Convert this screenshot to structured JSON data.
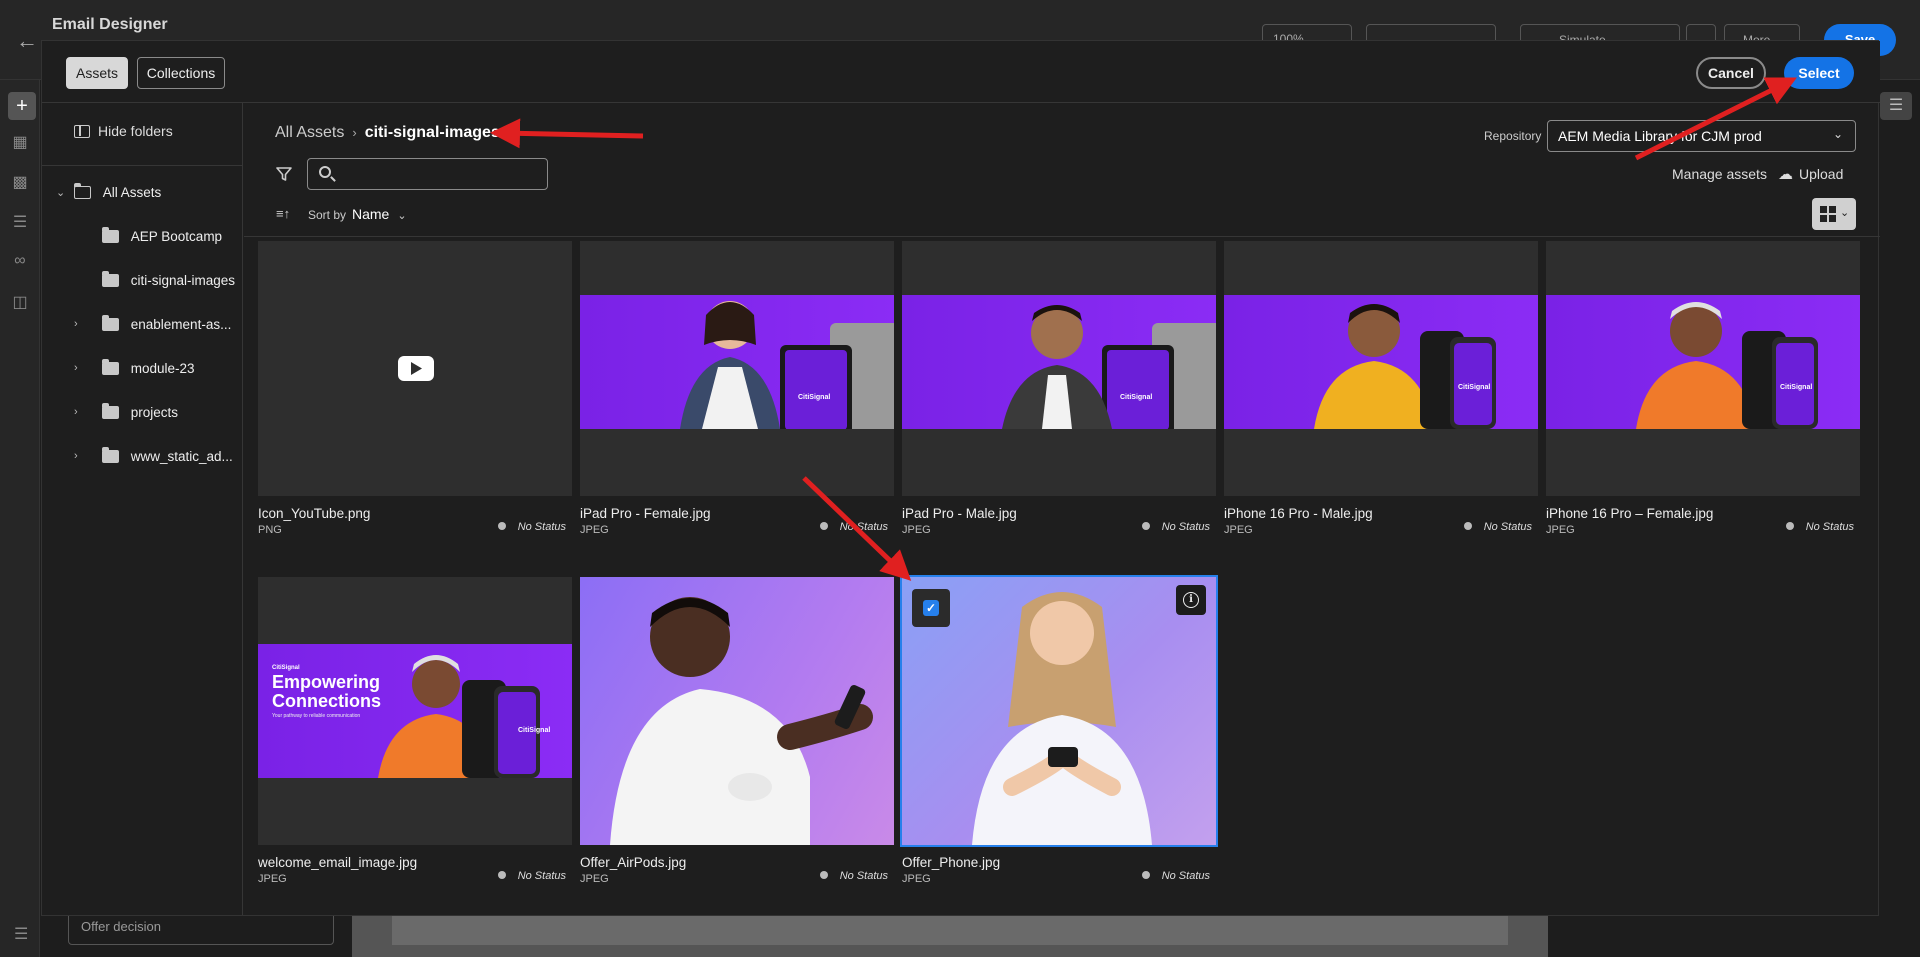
{
  "app": {
    "title": "Email Designer",
    "zoom": "100%",
    "simulate_label": "Simulate Content",
    "more_label": "More",
    "save_label": "Save",
    "offer_decision_label": "Offer decision"
  },
  "modal": {
    "tabs": [
      {
        "label": "Assets",
        "active": true
      },
      {
        "label": "Collections",
        "active": false
      }
    ],
    "cancel_label": "Cancel",
    "select_label": "Select"
  },
  "sidebar": {
    "hide_folders_label": "Hide folders",
    "root": {
      "label": "All Assets",
      "expanded": true
    },
    "folders": [
      {
        "label": "AEP Bootcamp",
        "expandable": false
      },
      {
        "label": "citi-signal-images",
        "expandable": false
      },
      {
        "label": "enablement-as...",
        "expandable": true
      },
      {
        "label": "module-23",
        "expandable": true
      },
      {
        "label": "projects",
        "expandable": true
      },
      {
        "label": "www_static_ad...",
        "expandable": true
      }
    ]
  },
  "breadcrumb": {
    "root": "All Assets",
    "current": "citi-signal-images"
  },
  "repository": {
    "label": "Repository",
    "value": "AEM Media Library for CJM prod"
  },
  "toolbar": {
    "search_placeholder": "",
    "manage_assets_label": "Manage assets",
    "upload_label": "Upload",
    "sort_by_label": "Sort by",
    "sort_value": "Name"
  },
  "assets": [
    {
      "name": "Icon_YouTube.png",
      "type": "PNG",
      "status": "No Status",
      "selected": false
    },
    {
      "name": "iPad Pro - Female.jpg",
      "type": "JPEG",
      "status": "No Status",
      "selected": false
    },
    {
      "name": "iPad Pro - Male.jpg",
      "type": "JPEG",
      "status": "No Status",
      "selected": false
    },
    {
      "name": "iPhone 16 Pro - Male.jpg",
      "type": "JPEG",
      "status": "No Status",
      "selected": false
    },
    {
      "name": "iPhone 16 Pro – Female.jpg",
      "type": "JPEG",
      "status": "No Status",
      "selected": false
    },
    {
      "name": "welcome_email_image.jpg",
      "type": "JPEG",
      "status": "No Status",
      "selected": false
    },
    {
      "name": "Offer_AirPods.jpg",
      "type": "JPEG",
      "status": "No Status",
      "selected": false
    },
    {
      "name": "Offer_Phone.jpg",
      "type": "JPEG",
      "status": "No Status",
      "selected": true
    }
  ],
  "thumb_text": {
    "brand": "CitiSignal",
    "welcome_small": "CitiSignal",
    "welcome_headline_1": "Empowering",
    "welcome_headline_2": "Connections",
    "welcome_tagline": "Your pathway to reliable communication"
  },
  "colors": {
    "accent": "#1473e6",
    "brand_purple": "#8b2cf5",
    "annotation_arrow": "#e02020"
  }
}
